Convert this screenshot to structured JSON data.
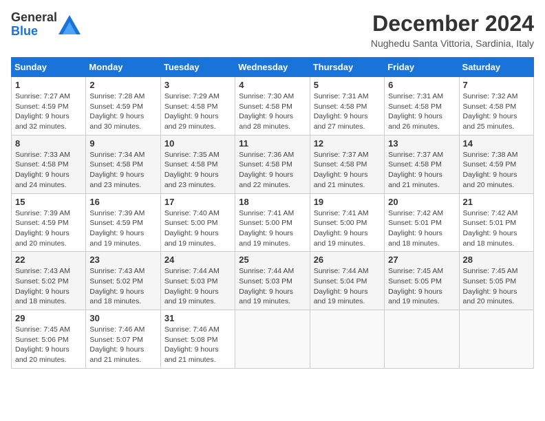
{
  "logo": {
    "line1": "General",
    "line2": "Blue"
  },
  "title": "December 2024",
  "location": "Nughedu Santa Vittoria, Sardinia, Italy",
  "days_of_week": [
    "Sunday",
    "Monday",
    "Tuesday",
    "Wednesday",
    "Thursday",
    "Friday",
    "Saturday"
  ],
  "weeks": [
    [
      {
        "day": "1",
        "sunrise": "7:27 AM",
        "sunset": "4:59 PM",
        "daylight": "9 hours and 32 minutes."
      },
      {
        "day": "2",
        "sunrise": "7:28 AM",
        "sunset": "4:59 PM",
        "daylight": "9 hours and 30 minutes."
      },
      {
        "day": "3",
        "sunrise": "7:29 AM",
        "sunset": "4:58 PM",
        "daylight": "9 hours and 29 minutes."
      },
      {
        "day": "4",
        "sunrise": "7:30 AM",
        "sunset": "4:58 PM",
        "daylight": "9 hours and 28 minutes."
      },
      {
        "day": "5",
        "sunrise": "7:31 AM",
        "sunset": "4:58 PM",
        "daylight": "9 hours and 27 minutes."
      },
      {
        "day": "6",
        "sunrise": "7:31 AM",
        "sunset": "4:58 PM",
        "daylight": "9 hours and 26 minutes."
      },
      {
        "day": "7",
        "sunrise": "7:32 AM",
        "sunset": "4:58 PM",
        "daylight": "9 hours and 25 minutes."
      }
    ],
    [
      {
        "day": "8",
        "sunrise": "7:33 AM",
        "sunset": "4:58 PM",
        "daylight": "9 hours and 24 minutes."
      },
      {
        "day": "9",
        "sunrise": "7:34 AM",
        "sunset": "4:58 PM",
        "daylight": "9 hours and 23 minutes."
      },
      {
        "day": "10",
        "sunrise": "7:35 AM",
        "sunset": "4:58 PM",
        "daylight": "9 hours and 23 minutes."
      },
      {
        "day": "11",
        "sunrise": "7:36 AM",
        "sunset": "4:58 PM",
        "daylight": "9 hours and 22 minutes."
      },
      {
        "day": "12",
        "sunrise": "7:37 AM",
        "sunset": "4:58 PM",
        "daylight": "9 hours and 21 minutes."
      },
      {
        "day": "13",
        "sunrise": "7:37 AM",
        "sunset": "4:58 PM",
        "daylight": "9 hours and 21 minutes."
      },
      {
        "day": "14",
        "sunrise": "7:38 AM",
        "sunset": "4:59 PM",
        "daylight": "9 hours and 20 minutes."
      }
    ],
    [
      {
        "day": "15",
        "sunrise": "7:39 AM",
        "sunset": "4:59 PM",
        "daylight": "9 hours and 20 minutes."
      },
      {
        "day": "16",
        "sunrise": "7:39 AM",
        "sunset": "4:59 PM",
        "daylight": "9 hours and 19 minutes."
      },
      {
        "day": "17",
        "sunrise": "7:40 AM",
        "sunset": "5:00 PM",
        "daylight": "9 hours and 19 minutes."
      },
      {
        "day": "18",
        "sunrise": "7:41 AM",
        "sunset": "5:00 PM",
        "daylight": "9 hours and 19 minutes."
      },
      {
        "day": "19",
        "sunrise": "7:41 AM",
        "sunset": "5:00 PM",
        "daylight": "9 hours and 19 minutes."
      },
      {
        "day": "20",
        "sunrise": "7:42 AM",
        "sunset": "5:01 PM",
        "daylight": "9 hours and 18 minutes."
      },
      {
        "day": "21",
        "sunrise": "7:42 AM",
        "sunset": "5:01 PM",
        "daylight": "9 hours and 18 minutes."
      }
    ],
    [
      {
        "day": "22",
        "sunrise": "7:43 AM",
        "sunset": "5:02 PM",
        "daylight": "9 hours and 18 minutes."
      },
      {
        "day": "23",
        "sunrise": "7:43 AM",
        "sunset": "5:02 PM",
        "daylight": "9 hours and 18 minutes."
      },
      {
        "day": "24",
        "sunrise": "7:44 AM",
        "sunset": "5:03 PM",
        "daylight": "9 hours and 19 minutes."
      },
      {
        "day": "25",
        "sunrise": "7:44 AM",
        "sunset": "5:03 PM",
        "daylight": "9 hours and 19 minutes."
      },
      {
        "day": "26",
        "sunrise": "7:44 AM",
        "sunset": "5:04 PM",
        "daylight": "9 hours and 19 minutes."
      },
      {
        "day": "27",
        "sunrise": "7:45 AM",
        "sunset": "5:05 PM",
        "daylight": "9 hours and 19 minutes."
      },
      {
        "day": "28",
        "sunrise": "7:45 AM",
        "sunset": "5:05 PM",
        "daylight": "9 hours and 20 minutes."
      }
    ],
    [
      {
        "day": "29",
        "sunrise": "7:45 AM",
        "sunset": "5:06 PM",
        "daylight": "9 hours and 20 minutes."
      },
      {
        "day": "30",
        "sunrise": "7:46 AM",
        "sunset": "5:07 PM",
        "daylight": "9 hours and 21 minutes."
      },
      {
        "day": "31",
        "sunrise": "7:46 AM",
        "sunset": "5:08 PM",
        "daylight": "9 hours and 21 minutes."
      },
      null,
      null,
      null,
      null
    ]
  ],
  "labels": {
    "sunrise": "Sunrise:",
    "sunset": "Sunset:",
    "daylight": "Daylight:"
  }
}
